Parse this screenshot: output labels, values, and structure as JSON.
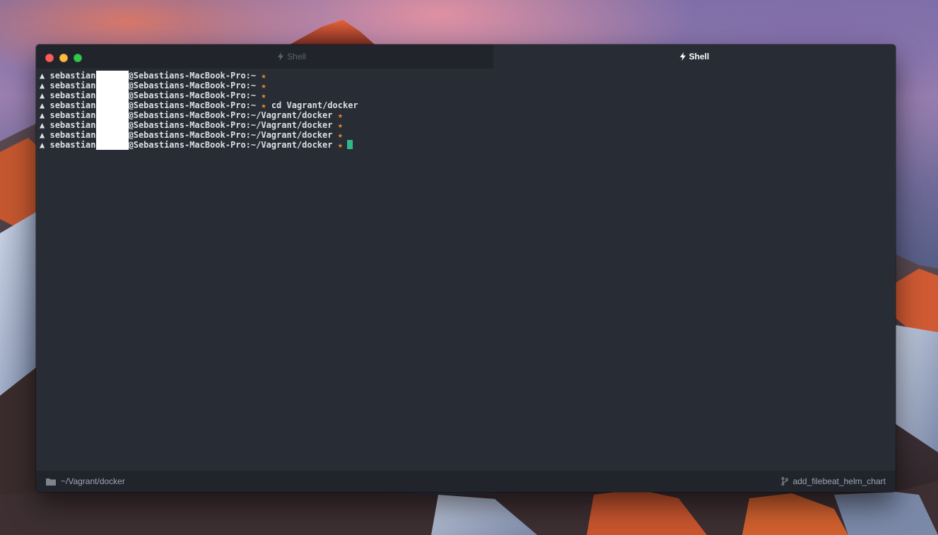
{
  "window": {
    "tabs": [
      {
        "label": "Shell",
        "active": false
      },
      {
        "label": "Shell",
        "active": true
      }
    ]
  },
  "terminal": {
    "prompt_symbol": "▲",
    "user_prefix": "sebastian",
    "host_suffix": "@Sebastians-MacBook-Pro:",
    "star": "★",
    "lines": [
      {
        "path": "~",
        "command": ""
      },
      {
        "path": "~",
        "command": ""
      },
      {
        "path": "~",
        "command": ""
      },
      {
        "path": "~",
        "command": "cd Vagrant/docker"
      },
      {
        "path": "~/Vagrant/docker",
        "command": ""
      },
      {
        "path": "~/Vagrant/docker",
        "command": ""
      },
      {
        "path": "~/Vagrant/docker",
        "command": ""
      },
      {
        "path": "~/Vagrant/docker",
        "command": ""
      }
    ]
  },
  "statusbar": {
    "cwd": "~/Vagrant/docker",
    "branch": "add_filebeat_helm_chart"
  },
  "colors": {
    "terminal_bg": "#282c34",
    "tab_inactive_bg": "#21252b",
    "star": "#e5892d",
    "cursor": "#2fb98a"
  }
}
